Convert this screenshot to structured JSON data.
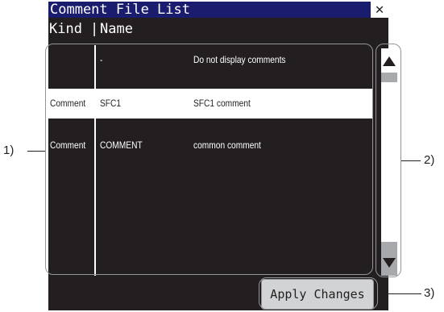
{
  "window": {
    "title": "Comment File List",
    "close_glyph": "✕"
  },
  "columns": {
    "kind": "Kind",
    "separator": "|",
    "name": "Name"
  },
  "rows": [
    {
      "kind": "",
      "name": "-",
      "description": "Do not display comments",
      "selected": false
    },
    {
      "kind": "Comment",
      "name": "SFC1",
      "description": "SFC1 comment",
      "selected": true
    },
    {
      "kind": "Comment",
      "name": "COMMENT",
      "description": "common comment",
      "selected": false
    }
  ],
  "scrollbar": {
    "up_icon": "triangle-up-icon",
    "down_icon": "triangle-down-icon"
  },
  "apply_button": {
    "label": "Apply Changes"
  },
  "callouts": {
    "one": "1)",
    "two": "2)",
    "three": "3)"
  },
  "colors": {
    "background": "#231f20",
    "title_bar": "#1a1c6e",
    "selected_row": "#ffffff",
    "button": "#d1d3d4",
    "scroll_gray": "#a7a9ac"
  }
}
